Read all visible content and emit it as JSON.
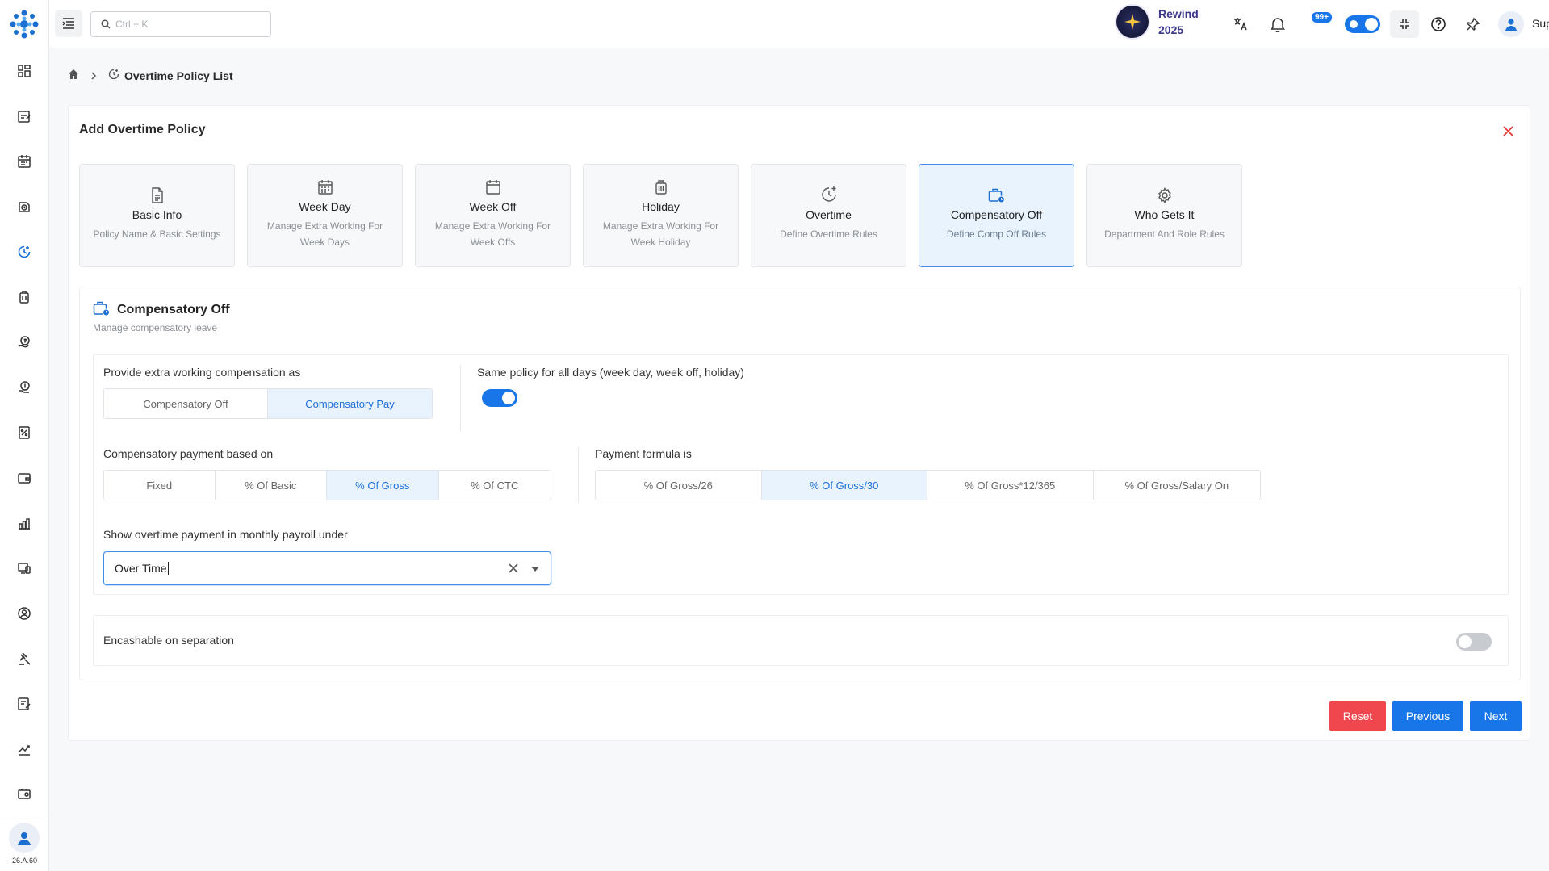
{
  "colors": {
    "accent": "#1976e8",
    "danger": "#f0474f",
    "active_step_bg": "#e8f3fd"
  },
  "sidebar": {
    "icons": [
      "dashboard-icon",
      "attendance-icon",
      "calendar-icon",
      "shift-icon",
      "overtime-icon",
      "leave-icon",
      "payroll-icon",
      "salary-icon",
      "tax-icon",
      "wallet-icon",
      "reports-icon",
      "assets-icon",
      "profile-icon",
      "legal-icon",
      "forms-icon",
      "analytics-icon",
      "settings-icon"
    ],
    "version": "26.A.60"
  },
  "topbar": {
    "search_placeholder": "Ctrl + K",
    "rewind_line1": "Rewind",
    "rewind_line2": "2025",
    "notification_count": "99+",
    "support_label": "Support"
  },
  "breadcrumb": {
    "title": "Overtime Policy List"
  },
  "card": {
    "title": "Add Overtime Policy",
    "steps": [
      {
        "title": "Basic Info",
        "sub": "Policy Name & Basic Settings",
        "icon": "document-icon"
      },
      {
        "title": "Week Day",
        "sub": "Manage Extra Working For Week Days",
        "icon": "calendar-grid-icon"
      },
      {
        "title": "Week Off",
        "sub": "Manage Extra Working For Week Offs",
        "icon": "calendar-blank-icon"
      },
      {
        "title": "Holiday",
        "sub": "Manage Extra Working For Week Holiday",
        "icon": "luggage-icon"
      },
      {
        "title": "Overtime",
        "sub": "Define Overtime Rules",
        "icon": "clock-plus-icon"
      },
      {
        "title": "Compensatory Off",
        "sub": "Define Comp Off Rules",
        "icon": "briefcase-clock-icon"
      },
      {
        "title": "Who Gets It",
        "sub": "Department And Role Rules",
        "icon": "gear-icon"
      }
    ]
  },
  "section": {
    "title": "Compensatory Off",
    "subtitle": "Manage compensatory leave",
    "compensation_label": "Provide extra working compensation as",
    "compensation_options": [
      "Compensatory Off",
      "Compensatory Pay"
    ],
    "same_policy_label": "Same policy for all days (week day, week off, holiday)",
    "payment_based_label": "Compensatory payment based on",
    "payment_based_options": [
      "Fixed",
      "% Of Basic",
      "% Of Gross",
      "% Of CTC"
    ],
    "formula_label": "Payment formula is",
    "formula_options": [
      "% Of Gross/26",
      "% Of Gross/30",
      "% Of Gross*12/365",
      "% Of Gross/Salary On"
    ],
    "payroll_label": "Show overtime payment in monthly payroll under",
    "payroll_value": "Over Time",
    "encash_label": "Encashable on separation"
  },
  "buttons": {
    "reset": "Reset",
    "previous": "Previous",
    "next": "Next"
  }
}
